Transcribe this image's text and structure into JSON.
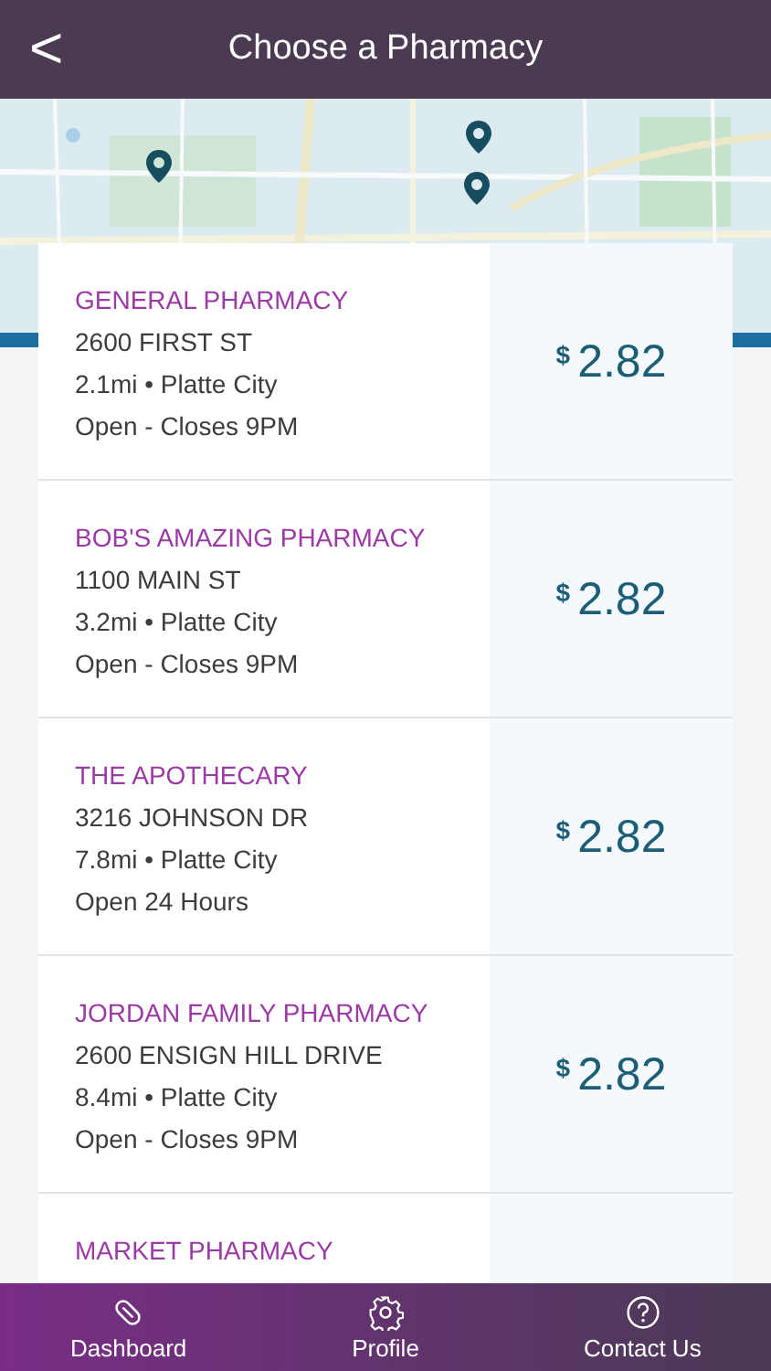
{
  "header": {
    "back": "<",
    "title": "Choose a Pharmacy"
  },
  "pharmacies": [
    {
      "name": "GENERAL PHARMACY",
      "address": "2600 FIRST ST",
      "distance": "2.1mi • Platte City",
      "hours": "Open - Closes 9PM",
      "currency": "$",
      "price": "2.82"
    },
    {
      "name": "BOB'S AMAZING PHARMACY",
      "address": "1100 MAIN ST",
      "distance": "3.2mi • Platte City",
      "hours": "Open - Closes 9PM",
      "currency": "$",
      "price": "2.82"
    },
    {
      "name": "THE APOTHECARY",
      "address": "3216 JOHNSON DR",
      "distance": "7.8mi • Platte City",
      "hours": "Open 24 Hours",
      "currency": "$",
      "price": "2.82"
    },
    {
      "name": "JORDAN FAMILY PHARMACY",
      "address": "2600 ENSIGN HILL DRIVE",
      "distance": "8.4mi • Platte City",
      "hours": "Open - Closes 9PM",
      "currency": "$",
      "price": "2.82"
    },
    {
      "name": "MARKET PHARMACY"
    }
  ],
  "nav": [
    {
      "kind": "pill",
      "label": "Dashboard"
    },
    {
      "kind": "gear",
      "label": "Profile"
    },
    {
      "kind": "help",
      "label": "Contact Us"
    }
  ]
}
